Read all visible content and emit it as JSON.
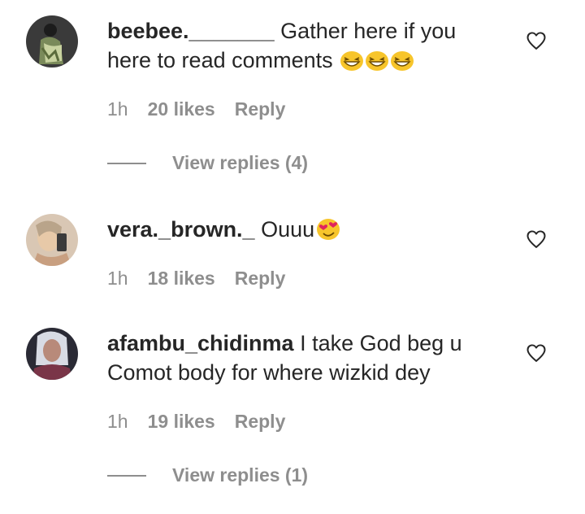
{
  "comments": [
    {
      "username": "beebee._______",
      "text": " Gather here if you here to read comments ",
      "emoji": [
        "grin-squint-emoji",
        "grin-squint-emoji",
        "grin-squint-emoji"
      ],
      "time": "1h",
      "likes": "20 likes",
      "reply": "Reply",
      "view_replies": "View replies (4)"
    },
    {
      "username": "vera._brown._",
      "text": " Ouuu",
      "emoji": [
        "heart-eyes-emoji"
      ],
      "time": "1h",
      "likes": "18 likes",
      "reply": "Reply"
    },
    {
      "username": "afambu_chidinma",
      "text": " I take God beg u Comot body for where wizkid dey",
      "emoji": [],
      "time": "1h",
      "likes": "19 likes",
      "reply": "Reply",
      "view_replies": "View replies (1)"
    }
  ],
  "icons": {
    "like": "heart-outline-icon"
  },
  "colors": {
    "text": "#262626",
    "muted": "#8e8e8e",
    "background": "#ffffff"
  }
}
